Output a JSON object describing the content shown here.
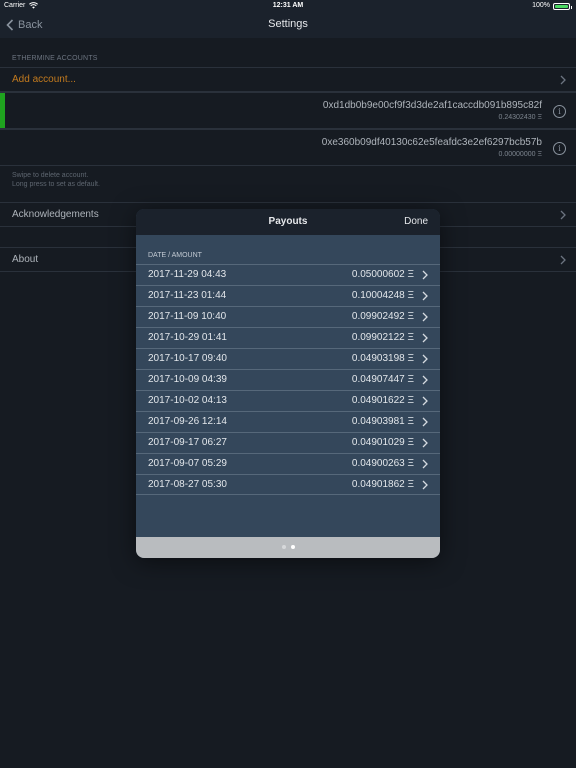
{
  "status_bar": {
    "carrier": "Carrier",
    "time": "12:31 AM",
    "battery": "100%"
  },
  "nav": {
    "back_label": "Back",
    "title": "Settings"
  },
  "accounts_section": {
    "header": "ETHERMINE ACCOUNTS",
    "add_label": "Add account...",
    "accounts": [
      {
        "address": "0xd1db0b9e00cf9f3d3de2af1caccdb091b895c82f",
        "balance": "0.24302430 Ξ",
        "is_default": true
      },
      {
        "address": "0xe360b09df40130c62e5feafdc3e2ef6297bcb57b",
        "balance": "0.00000000 Ξ",
        "is_default": false
      }
    ],
    "hint_line1": "Swipe to delete account.",
    "hint_line2": "Long press to set as default."
  },
  "menu": {
    "acknowledgements": "Acknowledgements",
    "about": "About"
  },
  "modal": {
    "title": "Payouts",
    "done_label": "Done",
    "column_header": "DATE / AMOUNT",
    "payouts": [
      {
        "date": "2017-11-29 04:43",
        "amount": "0.05000602 Ξ"
      },
      {
        "date": "2017-11-23 01:44",
        "amount": "0.10004248 Ξ"
      },
      {
        "date": "2017-11-09 10:40",
        "amount": "0.09902492 Ξ"
      },
      {
        "date": "2017-10-29 01:41",
        "amount": "0.09902122 Ξ"
      },
      {
        "date": "2017-10-17 09:40",
        "amount": "0.04903198 Ξ"
      },
      {
        "date": "2017-10-09 04:39",
        "amount": "0.04907447 Ξ"
      },
      {
        "date": "2017-10-02 04:13",
        "amount": "0.04901622 Ξ"
      },
      {
        "date": "2017-09-26 12:14",
        "amount": "0.04903981 Ξ"
      },
      {
        "date": "2017-09-17 06:27",
        "amount": "0.04901029 Ξ"
      },
      {
        "date": "2017-09-07 05:29",
        "amount": "0.04900263 Ξ"
      },
      {
        "date": "2017-08-27 05:30",
        "amount": "0.04901862 Ξ"
      }
    ],
    "page_count": 2,
    "current_page": 2
  },
  "colors": {
    "accent": "#c27a1e",
    "default_indicator": "#1fa31f",
    "battery": "#4cd964"
  }
}
